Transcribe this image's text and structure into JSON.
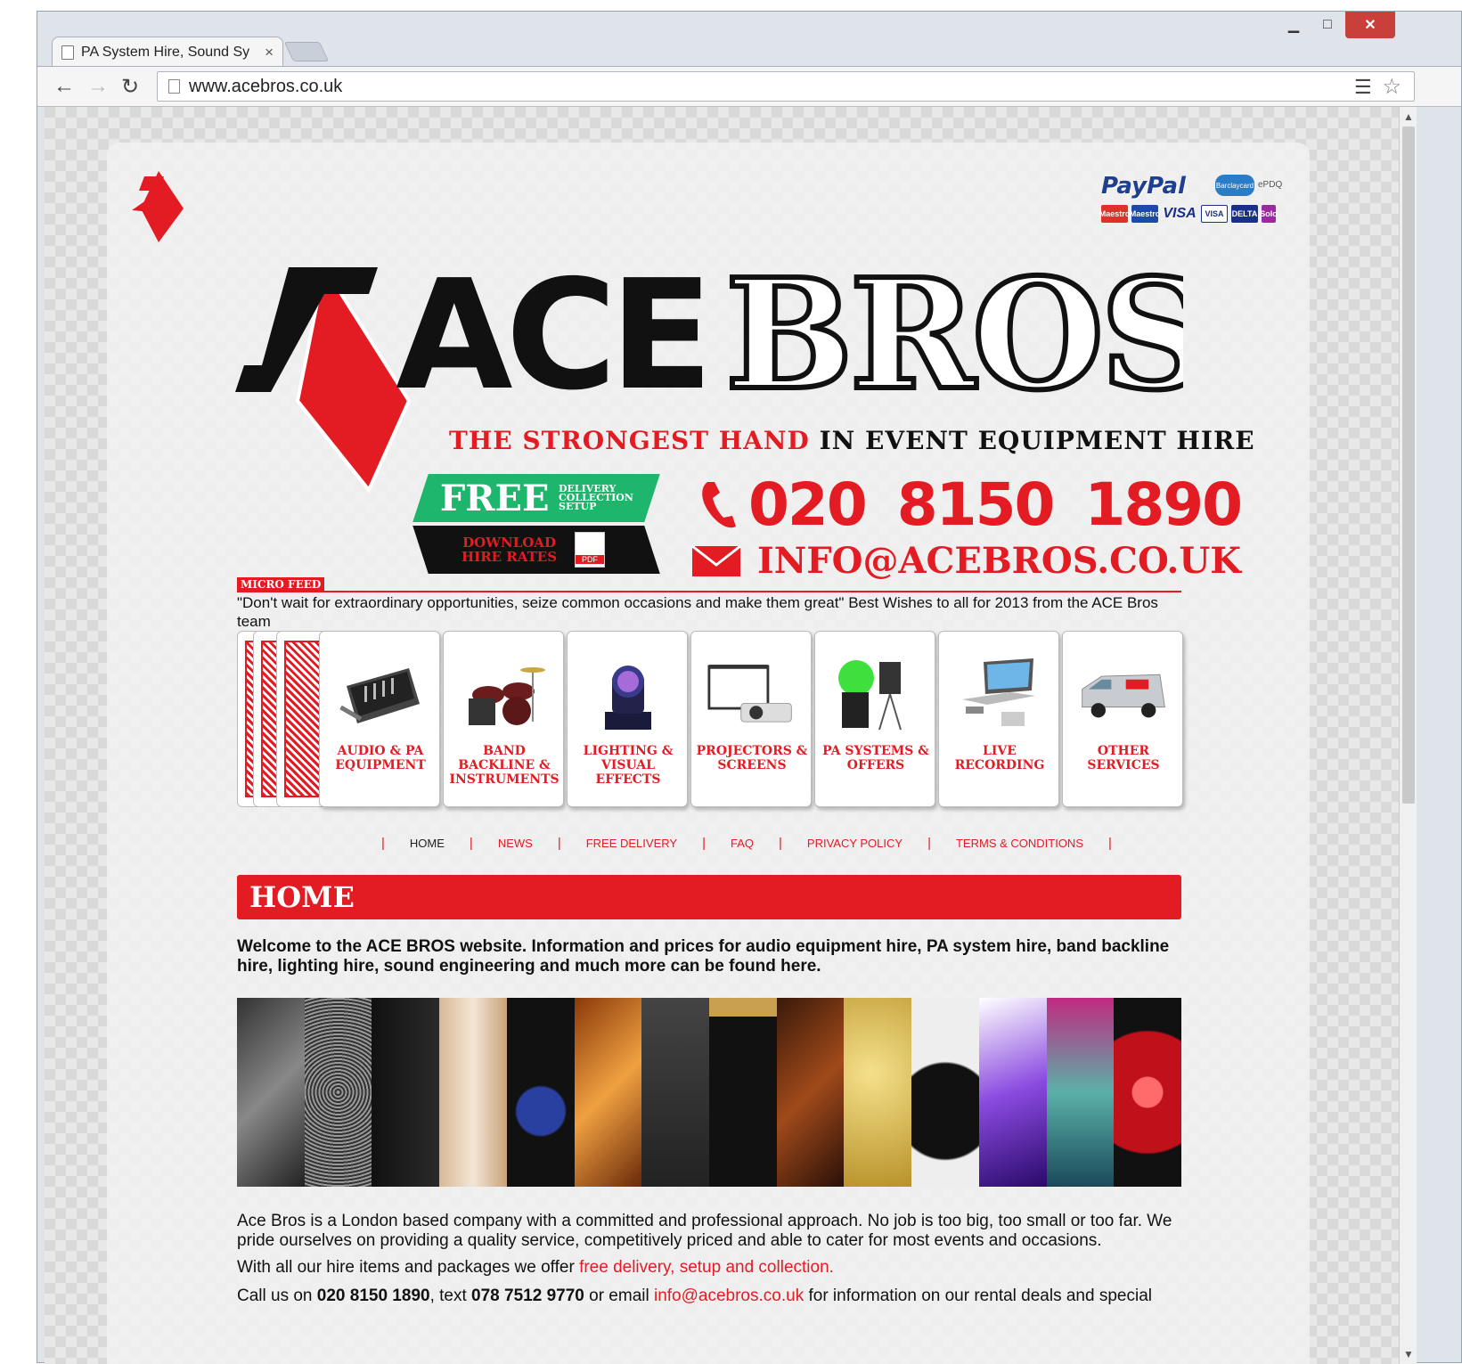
{
  "browser": {
    "tab_title": "PA System Hire, Sound Sy",
    "tab_close": "×",
    "url": "www.acebros.co.uk",
    "window_close": "✕",
    "window_min": "▁",
    "window_max": "□"
  },
  "header": {
    "paypal": "PayPal",
    "epdq": "ePDQ",
    "barclaycard": "Barclaycard",
    "cards": [
      "Maestro",
      "Maestro",
      "VISA",
      "VISA",
      "DELTA",
      "Solo"
    ],
    "brand_left": "ACE",
    "brand_right": "BROS",
    "tagline_red": "THE STRONGEST HAND",
    "tagline_black": "IN EVENT EQUIPMENT HIRE",
    "free_big": "FREE",
    "free_small": [
      "DELIVERY",
      "COLLECTION",
      "SETUP"
    ],
    "download": "DOWNLOAD",
    "hire_rates": "HIRE RATES",
    "pdf": "PDF",
    "phone": "020 8150 1890",
    "email": "INFO@ACEBROS.CO.UK"
  },
  "micro_feed": {
    "label": "MICRO FEED",
    "text": "\"Don't wait for extraordinary opportunities, seize common occasions and make them great\" Best Wishes to all for 2013 from the ACE Bros team"
  },
  "services": [
    {
      "label": "AUDIO & PA EQUIPMENT",
      "icon": "mixer-icon"
    },
    {
      "label": "BAND BACKLINE & INSTRUMENTS",
      "icon": "drums-icon"
    },
    {
      "label": "LIGHTING & VISUAL EFFECTS",
      "icon": "moving-light-icon"
    },
    {
      "label": "PROJECTORS & SCREENS",
      "icon": "projector-icon"
    },
    {
      "label": "PA SYSTEMS & OFFERS",
      "icon": "speakers-icon"
    },
    {
      "label": "LIVE RECORDING",
      "icon": "laptop-icon"
    },
    {
      "label": "OTHER SERVICES",
      "icon": "van-icon"
    }
  ],
  "nav": [
    "HOME",
    "NEWS",
    "FREE DELIVERY",
    "FAQ",
    "PRIVACY POLICY",
    "TERMS & CONDITIONS"
  ],
  "main": {
    "heading": "HOME",
    "welcome": "Welcome to the ACE BROS website. Information and prices for audio equipment hire, PA system hire, band backline hire, lighting hire, sound engineering and much more can be found here.",
    "p1": "Ace Bros is a London based company with a committed and professional approach. No job is too big, too small or too far. We pride ourselves on providing a quality service, competitively priced and able to cater for most events and occasions.",
    "p2_pre": "With all our hire items and packages we offer ",
    "p2_link": "free delivery, setup and collection.",
    "p3_a": "Call us on ",
    "p3_phone": "020 8150 1890",
    "p3_b": ", text ",
    "p3_text": "078 7512 9770",
    "p3_c": " or email ",
    "p3_email": "info@acebros.co.uk",
    "p3_d": " for information on our rental deals and special"
  },
  "colors": {
    "brand_red": "#e31b23",
    "green": "#1eb56d"
  }
}
